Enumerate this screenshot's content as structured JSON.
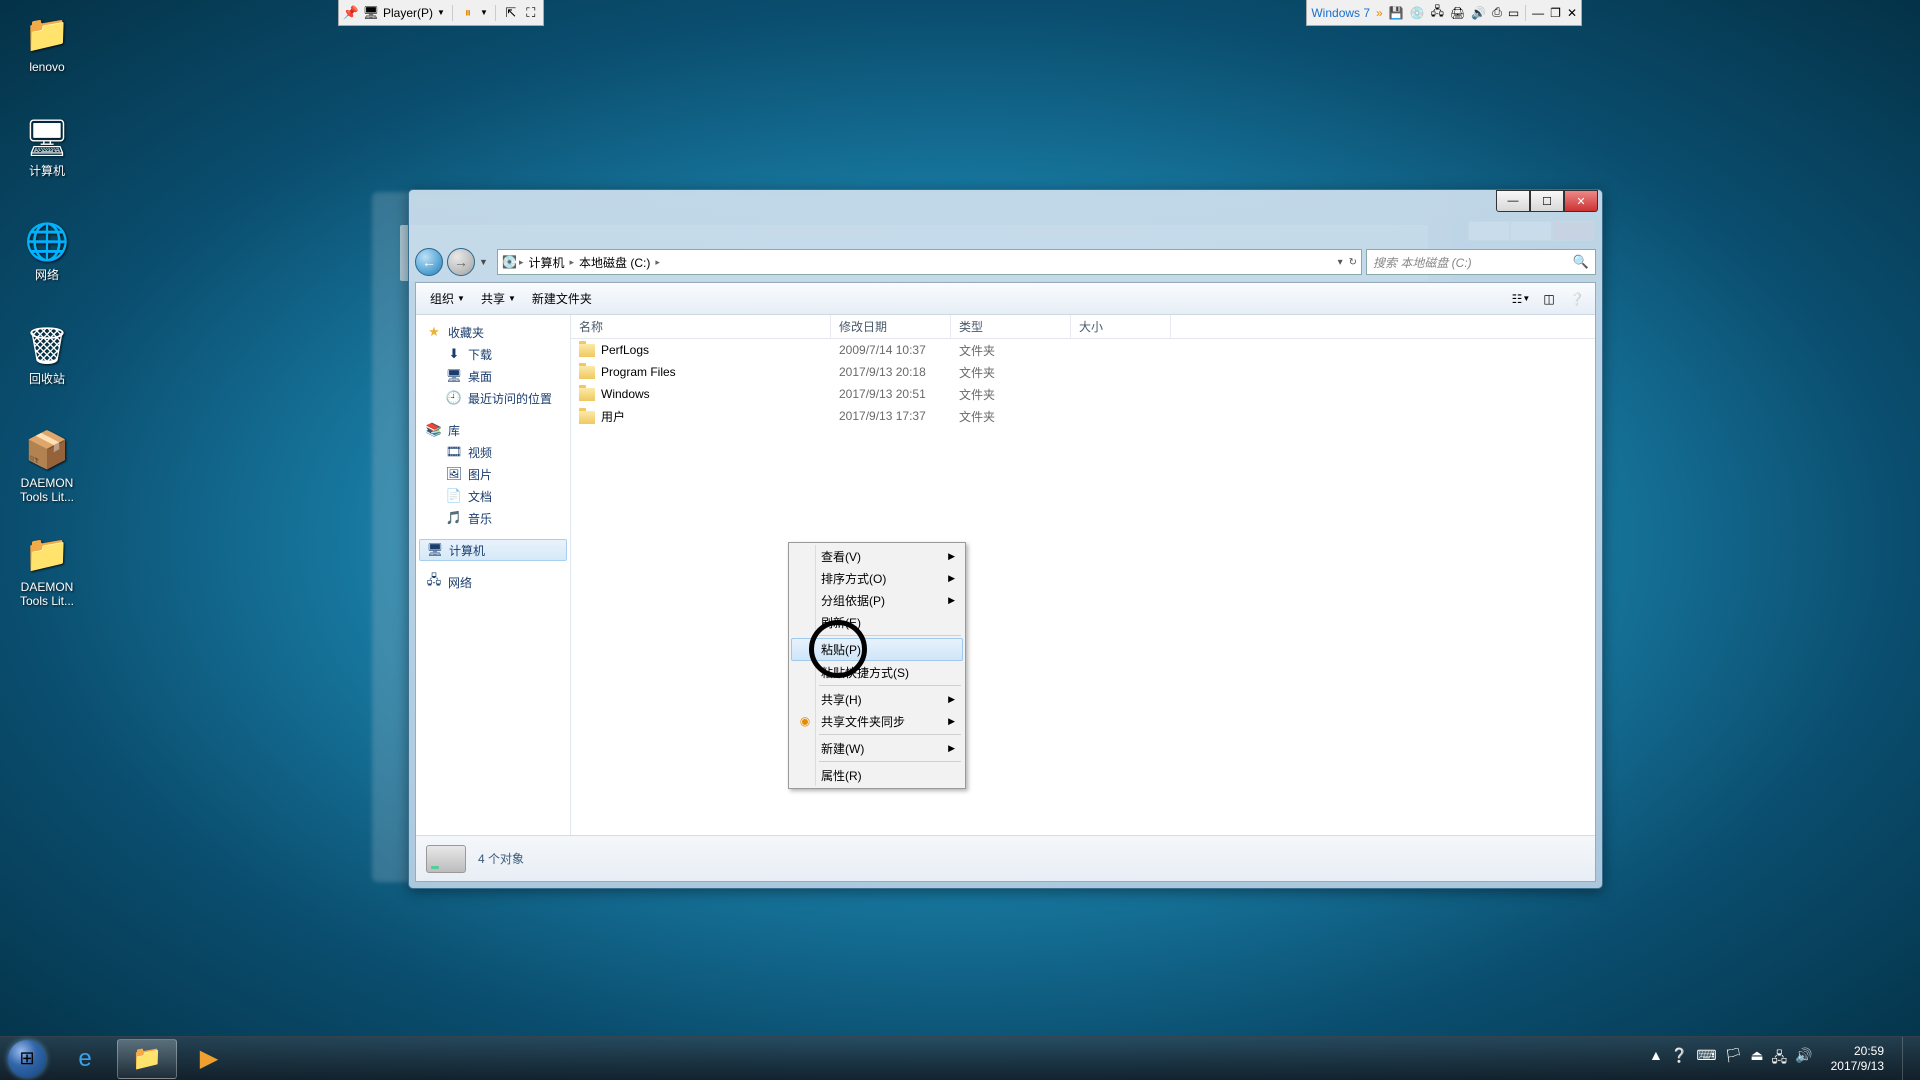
{
  "vm_toolbar": {
    "player": "Player(P)",
    "win_label": "Windows 7"
  },
  "desktop": {
    "icons": [
      {
        "label": "lenovo",
        "glyph": "📁"
      },
      {
        "label": "计算机",
        "glyph": "🖥"
      },
      {
        "label": "网络",
        "glyph": "🌐"
      },
      {
        "label": "回收站",
        "glyph": "🗑"
      },
      {
        "label": "DAEMON\nTools Lit...",
        "glyph": "📦"
      },
      {
        "label": "DAEMON\nTools Lit...",
        "glyph": "📁"
      }
    ]
  },
  "explorer": {
    "breadcrumb": {
      "computer": "计算机",
      "drive": "本地磁盘 (C:)"
    },
    "search_placeholder": "搜索 本地磁盘 (C:)",
    "toolbar": {
      "organize": "组织",
      "share": "共享",
      "new_folder": "新建文件夹"
    },
    "columns": {
      "name": "名称",
      "date": "修改日期",
      "type": "类型",
      "size": "大小"
    },
    "sidebar": {
      "favorites": {
        "title": "收藏夹",
        "items": [
          "下载",
          "桌面",
          "最近访问的位置"
        ]
      },
      "library": {
        "title": "库",
        "items": [
          "视频",
          "图片",
          "文档",
          "音乐"
        ]
      },
      "computer": {
        "title": "计算机"
      },
      "network": {
        "title": "网络"
      }
    },
    "files": [
      {
        "name": "PerfLogs",
        "date": "2009/7/14 10:37",
        "type": "文件夹"
      },
      {
        "name": "Program Files",
        "date": "2017/9/13 20:18",
        "type": "文件夹"
      },
      {
        "name": "Windows",
        "date": "2017/9/13 20:51",
        "type": "文件夹"
      },
      {
        "name": "用户",
        "date": "2017/9/13 17:37",
        "type": "文件夹"
      }
    ],
    "status": "4 个对象"
  },
  "context_menu": {
    "view": "查看(V)",
    "sort": "排序方式(O)",
    "group": "分组依据(P)",
    "refresh": "刷新(E)",
    "paste": "粘贴(P)",
    "paste_shortcut": "粘贴快捷方式(S)",
    "share": "共享(H)",
    "sync": "共享文件夹同步",
    "new": "新建(W)",
    "properties": "属性(R)"
  },
  "taskbar": {
    "time": "20:59",
    "date": "2017/9/13"
  }
}
